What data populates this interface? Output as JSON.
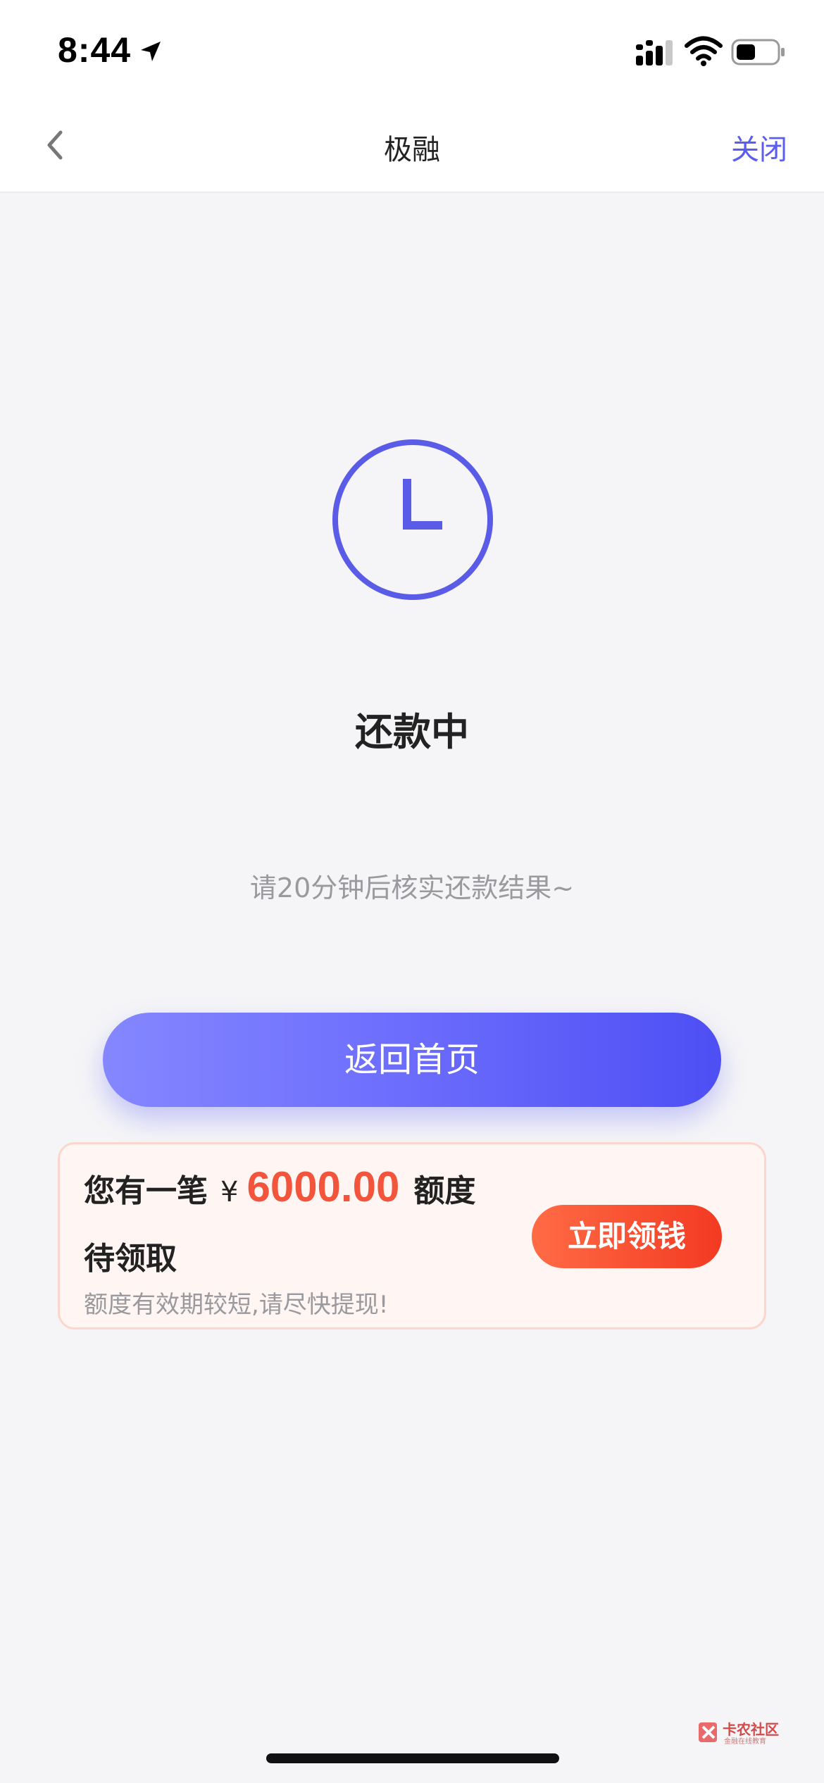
{
  "status_bar": {
    "time": "8:44",
    "icons": [
      "location-arrow-icon",
      "cellular-signal-icon",
      "wifi-icon",
      "battery-icon"
    ]
  },
  "nav": {
    "title": "极融",
    "close_label": "关闭",
    "back_icon": "chevron-left-icon"
  },
  "status": {
    "icon": "clock-icon",
    "title": "还款中",
    "subtitle": "请20分钟后核实还款结果~"
  },
  "home_button": {
    "label": "返回首页"
  },
  "promo": {
    "prefix": "您有一笔",
    "currency": "¥",
    "amount": "6000.00",
    "suffix": "额度",
    "line2": "待领取",
    "note": "额度有效期较短,请尽快提现!",
    "button_label": "立即领钱"
  },
  "watermark": {
    "title": "卡农社区",
    "subtitle": "金融在线教育"
  },
  "colors": {
    "accent": "#5b5cf0",
    "button_gradient_start": "#8487ff",
    "button_gradient_end": "#4e4ff4",
    "promo_amount": "#f2553c",
    "claim_gradient_start": "#ff6b45",
    "claim_gradient_end": "#f33a22",
    "background": "#f5f5f7"
  }
}
